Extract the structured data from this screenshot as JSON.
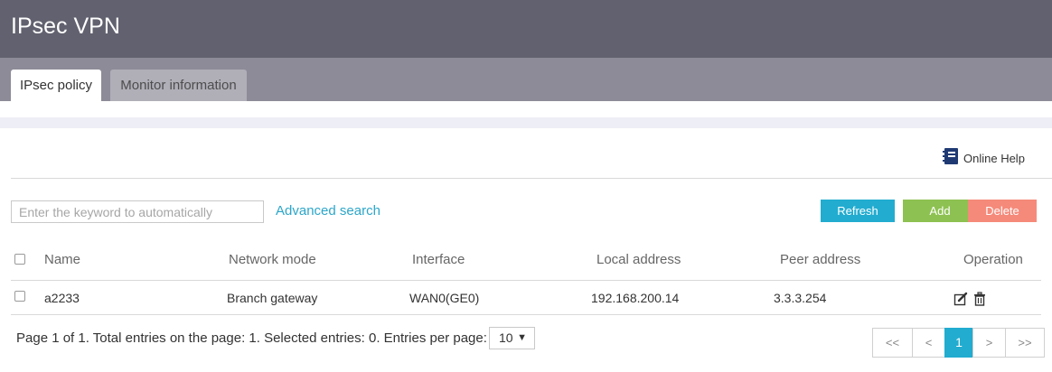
{
  "header": {
    "title": "IPsec VPN"
  },
  "tabs": [
    {
      "label": "IPsec policy",
      "active": true
    },
    {
      "label": "Monitor information",
      "active": false
    }
  ],
  "help": {
    "label": "Online Help",
    "icon": "help-book-icon"
  },
  "search": {
    "placeholder": "Enter the keyword to automatically",
    "value": ""
  },
  "advanced_search": "Advanced search",
  "toolbar": {
    "refresh": "Refresh",
    "add": "Add",
    "delete": "Delete"
  },
  "table": {
    "columns": {
      "name": "Name",
      "network_mode": "Network mode",
      "interface": "Interface",
      "local_address": "Local address",
      "peer_address": "Peer address",
      "operation": "Operation"
    },
    "rows": [
      {
        "name": "a2233",
        "network_mode": "Branch gateway",
        "interface": "WAN0(GE0)",
        "local_address": "192.168.200.14",
        "peer_address": "3.3.3.254"
      }
    ]
  },
  "footer": {
    "summary": "Page 1 of 1. Total entries on the page: 1. Selected entries: 0. Entries per page:",
    "per_page": "10"
  },
  "pager": {
    "first": "<<",
    "prev": "<",
    "current": "1",
    "next": ">",
    "last": ">>"
  },
  "colors": {
    "header": "#62616f",
    "tabbar": "#8d8b97",
    "refresh": "#22acd0",
    "add": "#8dc151",
    "delete": "#f58a7a",
    "link": "#2ca6c9"
  }
}
